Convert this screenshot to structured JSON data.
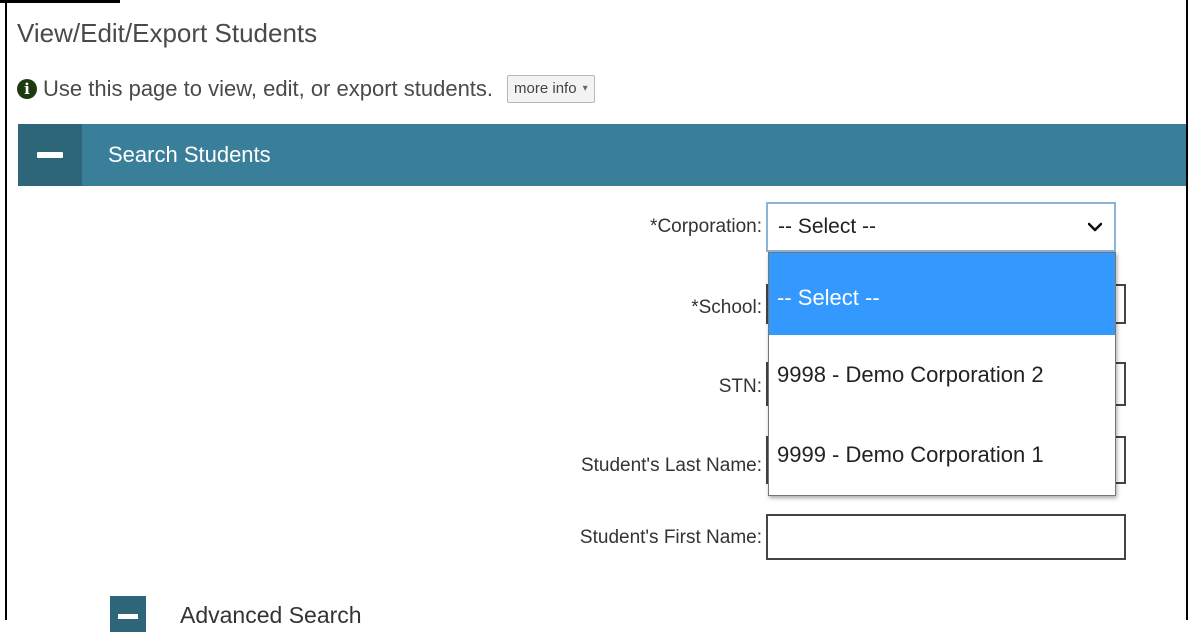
{
  "page": {
    "title": "View/Edit/Export Students",
    "info_text": "Use this page to view, edit, or export students.",
    "more_info_label": "more info",
    "info_icon": "info-circle-icon"
  },
  "panel": {
    "title": "Search Students",
    "header_color": "#3a7f99"
  },
  "form": {
    "corporation_label": "*Corporation:",
    "corporation_value": "-- Select --",
    "school_label": "*School:",
    "stn_label": "STN:",
    "last_name_label": "Student's Last Name:",
    "first_name_label": "Student's First Name:",
    "first_name_value": ""
  },
  "dropdown": {
    "options": [
      {
        "label": "-- Select --",
        "selected": true
      },
      {
        "label": "9998 - Demo Corporation 2",
        "selected": false
      },
      {
        "label": "9999 - Demo Corporation 1",
        "selected": false
      }
    ],
    "highlight_color": "#3399ff"
  },
  "advanced": {
    "title": "Advanced Search"
  }
}
